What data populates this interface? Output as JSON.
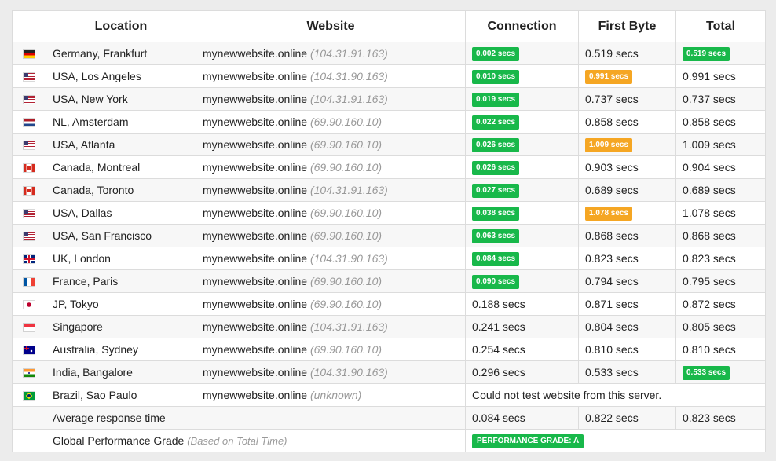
{
  "headers": {
    "location": "Location",
    "website": "Website",
    "connection": "Connection",
    "first_byte": "First Byte",
    "total": "Total"
  },
  "colors": {
    "green": "#18b84a",
    "orange": "#f5a623"
  },
  "rows": [
    {
      "flag": "de",
      "location": "Germany, Frankfurt",
      "site": "mynewwebsite.online",
      "ip": "(104.31.91.163)",
      "connection": "0.002 secs",
      "connection_style": "green",
      "first_byte": "0.519 secs",
      "first_byte_style": "",
      "total": "0.519 secs",
      "total_style": "green"
    },
    {
      "flag": "us",
      "location": "USA, Los Angeles",
      "site": "mynewwebsite.online",
      "ip": "(104.31.90.163)",
      "connection": "0.010 secs",
      "connection_style": "green",
      "first_byte": "0.991 secs",
      "first_byte_style": "orange",
      "total": "0.991 secs",
      "total_style": ""
    },
    {
      "flag": "us",
      "location": "USA, New York",
      "site": "mynewwebsite.online",
      "ip": "(104.31.91.163)",
      "connection": "0.019 secs",
      "connection_style": "green",
      "first_byte": "0.737 secs",
      "first_byte_style": "",
      "total": "0.737 secs",
      "total_style": ""
    },
    {
      "flag": "nl",
      "location": "NL, Amsterdam",
      "site": "mynewwebsite.online",
      "ip": "(69.90.160.10)",
      "connection": "0.022 secs",
      "connection_style": "green",
      "first_byte": "0.858 secs",
      "first_byte_style": "",
      "total": "0.858 secs",
      "total_style": ""
    },
    {
      "flag": "us",
      "location": "USA, Atlanta",
      "site": "mynewwebsite.online",
      "ip": "(69.90.160.10)",
      "connection": "0.026 secs",
      "connection_style": "green",
      "first_byte": "1.009 secs",
      "first_byte_style": "orange",
      "total": "1.009 secs",
      "total_style": ""
    },
    {
      "flag": "ca",
      "location": "Canada, Montreal",
      "site": "mynewwebsite.online",
      "ip": "(69.90.160.10)",
      "connection": "0.026 secs",
      "connection_style": "green",
      "first_byte": "0.903 secs",
      "first_byte_style": "",
      "total": "0.904 secs",
      "total_style": ""
    },
    {
      "flag": "ca",
      "location": "Canada, Toronto",
      "site": "mynewwebsite.online",
      "ip": "(104.31.91.163)",
      "connection": "0.027 secs",
      "connection_style": "green",
      "first_byte": "0.689 secs",
      "first_byte_style": "",
      "total": "0.689 secs",
      "total_style": ""
    },
    {
      "flag": "us",
      "location": "USA, Dallas",
      "site": "mynewwebsite.online",
      "ip": "(69.90.160.10)",
      "connection": "0.038 secs",
      "connection_style": "green",
      "first_byte": "1.078 secs",
      "first_byte_style": "orange",
      "total": "1.078 secs",
      "total_style": ""
    },
    {
      "flag": "us",
      "location": "USA, San Francisco",
      "site": "mynewwebsite.online",
      "ip": "(69.90.160.10)",
      "connection": "0.063 secs",
      "connection_style": "green",
      "first_byte": "0.868 secs",
      "first_byte_style": "",
      "total": "0.868 secs",
      "total_style": ""
    },
    {
      "flag": "uk",
      "location": "UK, London",
      "site": "mynewwebsite.online",
      "ip": "(104.31.90.163)",
      "connection": "0.084 secs",
      "connection_style": "green",
      "first_byte": "0.823 secs",
      "first_byte_style": "",
      "total": "0.823 secs",
      "total_style": ""
    },
    {
      "flag": "fr",
      "location": "France, Paris",
      "site": "mynewwebsite.online",
      "ip": "(69.90.160.10)",
      "connection": "0.090 secs",
      "connection_style": "green",
      "first_byte": "0.794 secs",
      "first_byte_style": "",
      "total": "0.795 secs",
      "total_style": ""
    },
    {
      "flag": "jp",
      "location": "JP, Tokyo",
      "site": "mynewwebsite.online",
      "ip": "(69.90.160.10)",
      "connection": "0.188 secs",
      "connection_style": "",
      "first_byte": "0.871 secs",
      "first_byte_style": "",
      "total": "0.872 secs",
      "total_style": ""
    },
    {
      "flag": "sg",
      "location": "Singapore",
      "site": "mynewwebsite.online",
      "ip": "(104.31.91.163)",
      "connection": "0.241 secs",
      "connection_style": "",
      "first_byte": "0.804 secs",
      "first_byte_style": "",
      "total": "0.805 secs",
      "total_style": ""
    },
    {
      "flag": "au",
      "location": "Australia, Sydney",
      "site": "mynewwebsite.online",
      "ip": "(69.90.160.10)",
      "connection": "0.254 secs",
      "connection_style": "",
      "first_byte": "0.810 secs",
      "first_byte_style": "",
      "total": "0.810 secs",
      "total_style": ""
    },
    {
      "flag": "in",
      "location": "India, Bangalore",
      "site": "mynewwebsite.online",
      "ip": "(104.31.90.163)",
      "connection": "0.296 secs",
      "connection_style": "",
      "first_byte": "0.533 secs",
      "first_byte_style": "",
      "total": "0.533 secs",
      "total_style": "green"
    },
    {
      "flag": "br",
      "location": "Brazil, Sao Paulo",
      "site": "mynewwebsite.online",
      "ip": "(unknown)",
      "error": "Could not test website from this server."
    }
  ],
  "average": {
    "label": "Average response time",
    "connection": "0.084 secs",
    "first_byte": "0.822 secs",
    "total": "0.823 secs"
  },
  "grade": {
    "label": "Global Performance Grade",
    "note": "(Based on Total Time)",
    "badge": "PERFORMANCE GRADE:  A"
  }
}
